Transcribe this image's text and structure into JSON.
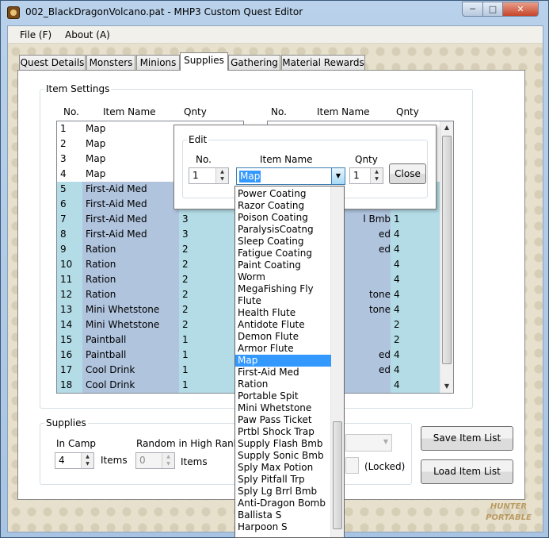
{
  "window": {
    "title": "002_BlackDragonVolcano.pat - MHP3 Custom Quest Editor",
    "min": "─",
    "max": "□",
    "close": "✕"
  },
  "menu": [
    "File (F)",
    "About (A)"
  ],
  "tabs": [
    "Quest Details",
    "Monsters",
    "Minions",
    "Supplies",
    "Gathering",
    "Material Rewards"
  ],
  "active_tab": "Supplies",
  "item_settings": {
    "legend": "Item Settings",
    "headers": {
      "no": "No.",
      "name": "Item Name",
      "qnty": "Qnty"
    },
    "left_rows": [
      {
        "no": "1",
        "name": "Map",
        "qnty": ""
      },
      {
        "no": "2",
        "name": "Map",
        "qnty": ""
      },
      {
        "no": "3",
        "name": "Map",
        "qnty": ""
      },
      {
        "no": "4",
        "name": "Map",
        "qnty": ""
      },
      {
        "no": "5",
        "name": "First-Aid Med",
        "qnty": ""
      },
      {
        "no": "6",
        "name": "First-Aid Med",
        "qnty": ""
      },
      {
        "no": "7",
        "name": "First-Aid Med",
        "qnty": "3"
      },
      {
        "no": "8",
        "name": "First-Aid Med",
        "qnty": "3"
      },
      {
        "no": "9",
        "name": "Ration",
        "qnty": "2"
      },
      {
        "no": "10",
        "name": "Ration",
        "qnty": "2"
      },
      {
        "no": "11",
        "name": "Ration",
        "qnty": "2"
      },
      {
        "no": "12",
        "name": "Ration",
        "qnty": "2"
      },
      {
        "no": "13",
        "name": "Mini Whetstone",
        "qnty": "2"
      },
      {
        "no": "14",
        "name": "Mini Whetstone",
        "qnty": "2"
      },
      {
        "no": "15",
        "name": "Paintball",
        "qnty": "1"
      },
      {
        "no": "16",
        "name": "Paintball",
        "qnty": "1"
      },
      {
        "no": "17",
        "name": "Cool Drink",
        "qnty": "1"
      },
      {
        "no": "18",
        "name": "Cool Drink",
        "qnty": "1"
      }
    ],
    "right_rows": [
      {
        "name": "",
        "qnty": ""
      },
      {
        "name": "",
        "qnty": ""
      },
      {
        "name": "",
        "qnty": ""
      },
      {
        "name": "",
        "qnty": ""
      },
      {
        "name": "",
        "qnty": ""
      },
      {
        "name": "",
        "qnty": ""
      },
      {
        "name": "l Bmb",
        "qnty": "1"
      },
      {
        "name": "ed",
        "qnty": "4"
      },
      {
        "name": "ed",
        "qnty": "4"
      },
      {
        "name": "",
        "qnty": "4"
      },
      {
        "name": "",
        "qnty": "4"
      },
      {
        "name": "tone",
        "qnty": "4"
      },
      {
        "name": "tone",
        "qnty": "4"
      },
      {
        "name": "",
        "qnty": "2"
      },
      {
        "name": "",
        "qnty": "2"
      },
      {
        "name": "ed",
        "qnty": "4"
      },
      {
        "name": "ed",
        "qnty": "4"
      },
      {
        "name": "",
        "qnty": "4"
      }
    ]
  },
  "edit": {
    "legend": "Edit",
    "no_label": "No.",
    "name_label": "Item Name",
    "qnty_label": "Qnty",
    "no_value": "1",
    "item_value": "Map",
    "qnty_value": "1",
    "close": "Close"
  },
  "dropdown_items": [
    "Power Coating",
    "Razor Coating",
    "Poison Coating",
    "ParalysisCoatng",
    "Sleep Coating",
    "Fatigue Coating",
    "Paint Coating",
    "Worm",
    "MegaFishing Fly",
    "Flute",
    "Health Flute",
    "Antidote Flute",
    "Demon Flute",
    "Armor Flute",
    "Map",
    "First-Aid Med",
    "Ration",
    "Portable Spit",
    "Mini Whetstone",
    "Paw Pass Ticket",
    "Prtbl Shock Trap",
    "Supply Flash Bmb",
    "Supply Sonic Bmb",
    "Sply Max Potion",
    "Sply Pitfall Trp",
    "Sply Lg Brrl Bmb",
    "Anti-Dragon Bomb",
    "Ballista S",
    "Harpoon S"
  ],
  "dropdown_selected": "Map",
  "supplies": {
    "legend": "Supplies",
    "in_camp": "In Camp",
    "in_camp_value": "4",
    "items": "Items",
    "random_high": "Random in High Rank",
    "random_value": "0",
    "items2": "Items",
    "locked": "(Locked)"
  },
  "buttons": {
    "save": "Save Item List",
    "load": "Load Item List"
  },
  "logo": "HUNTER PORTABLE",
  "colors": {
    "row_cyan": "#b4dce6",
    "row_blue": "#b0c4de",
    "select": "#3399ff"
  }
}
